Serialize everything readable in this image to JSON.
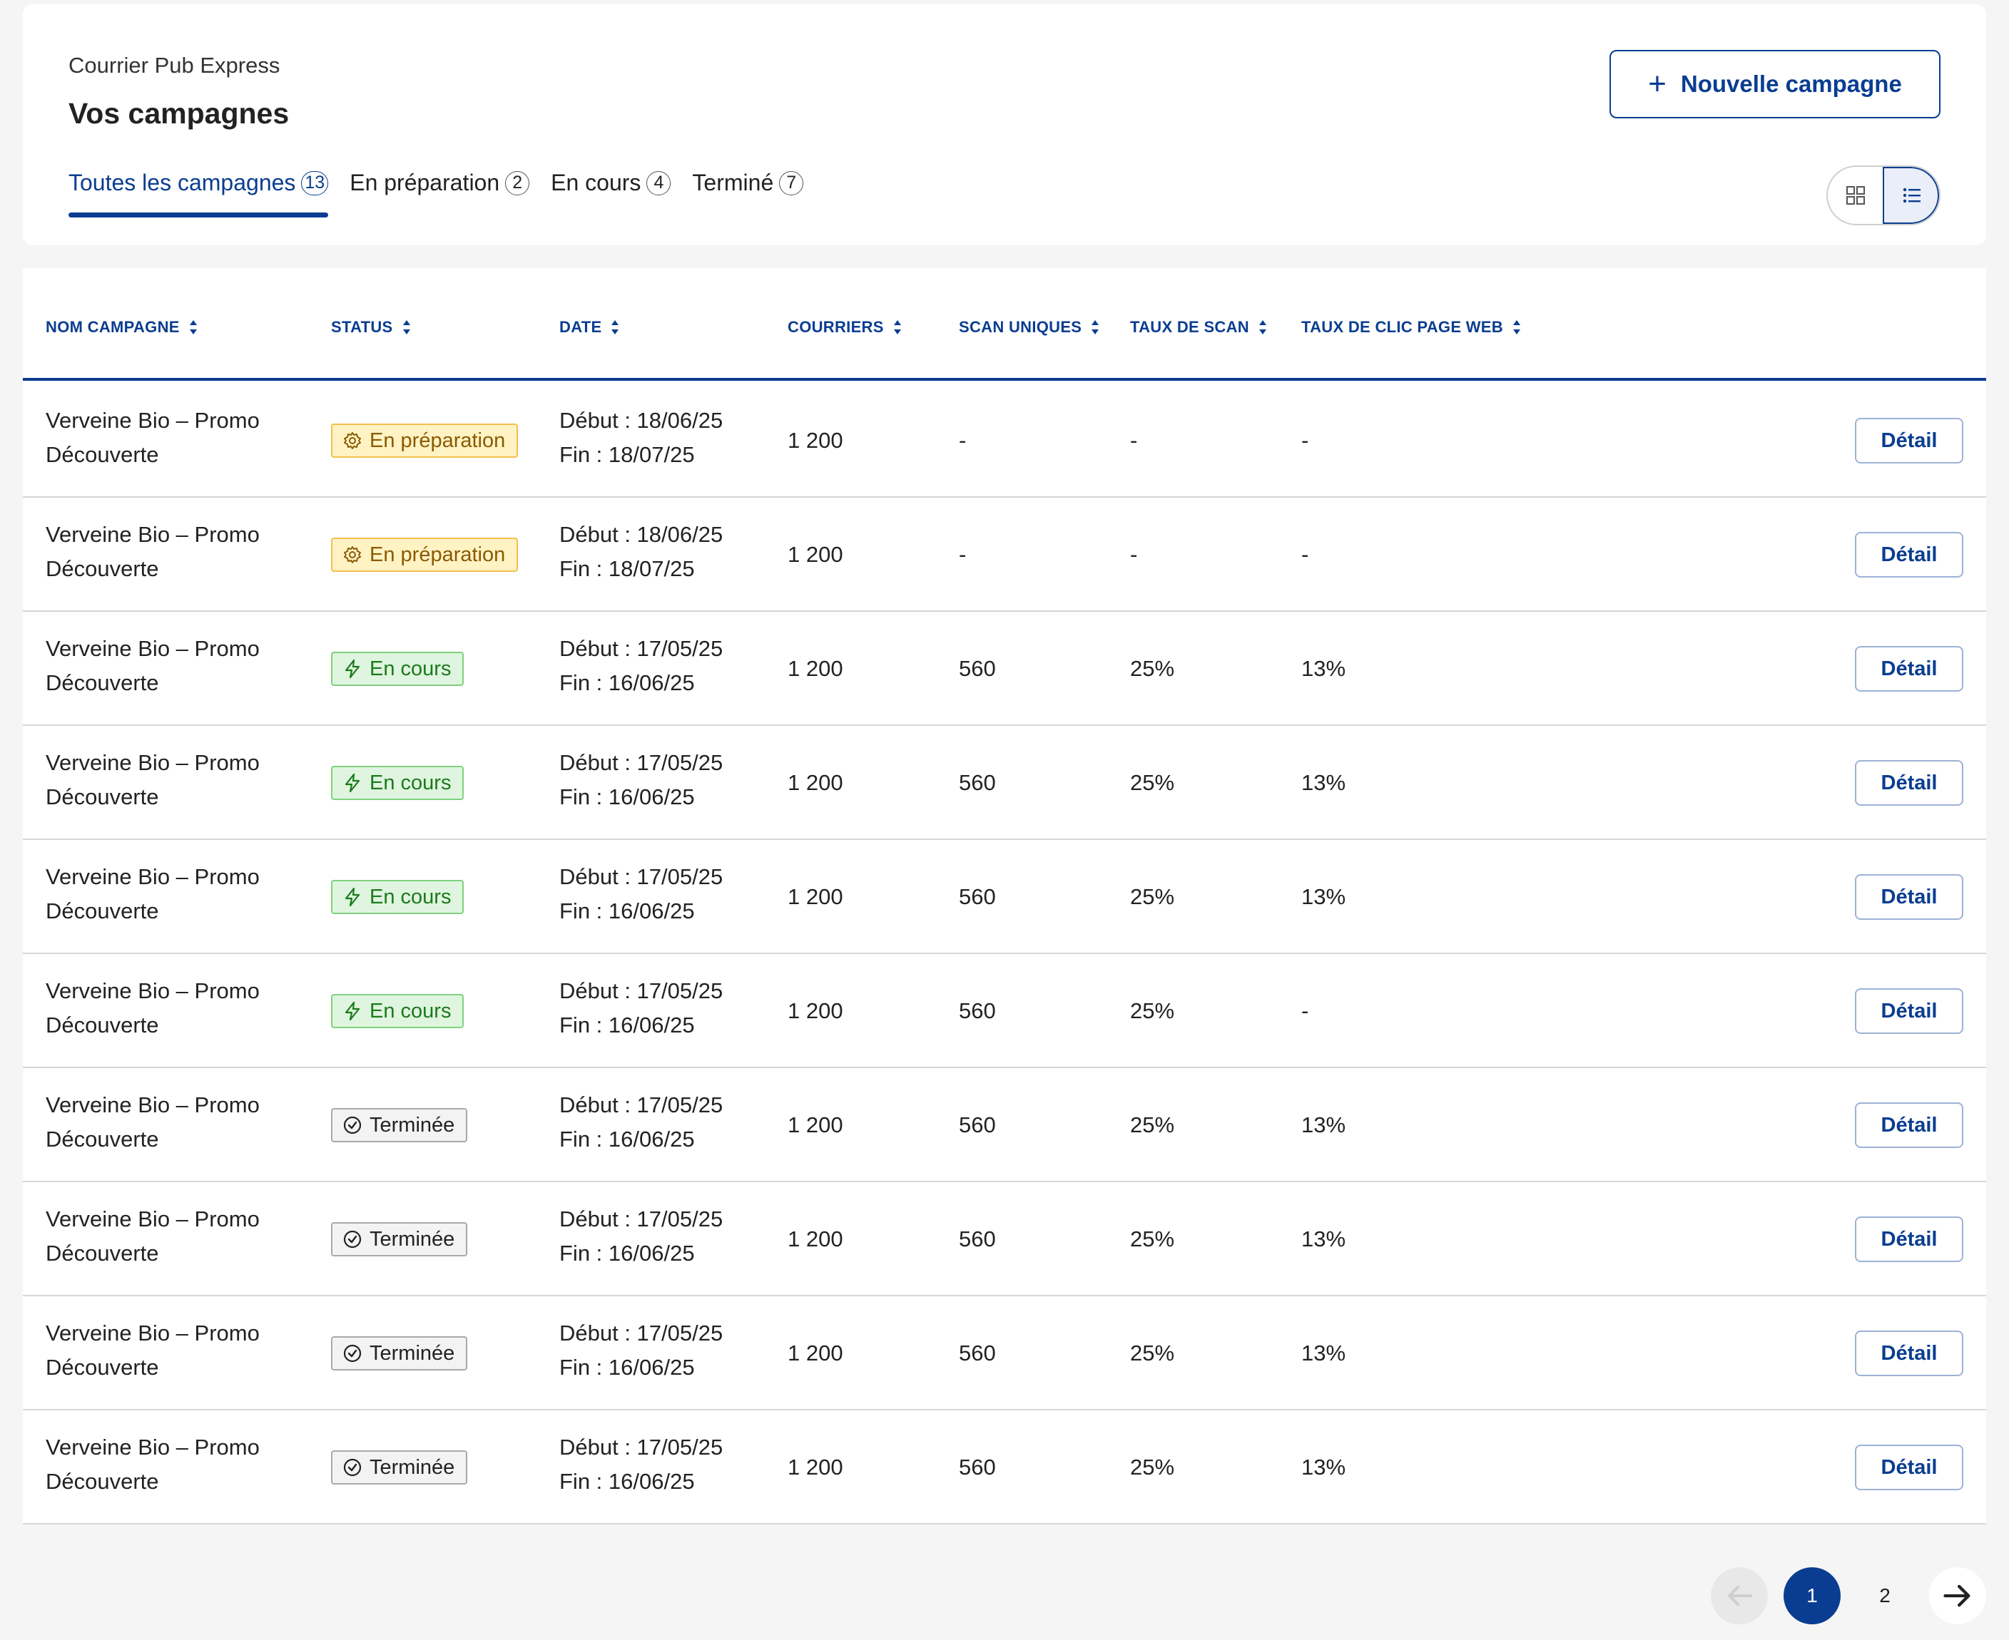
{
  "header": {
    "brand": "Courrier Pub Express",
    "title": "Vos campagnes",
    "new_button": "Nouvelle campagne",
    "new_button_icon": "plus-icon"
  },
  "tabs": [
    {
      "label": "Toutes les campagnes",
      "count": "13",
      "active": true
    },
    {
      "label": "En préparation",
      "count": "2",
      "active": false
    },
    {
      "label": "En cours",
      "count": "4",
      "active": false
    },
    {
      "label": "Terminé",
      "count": "7",
      "active": false
    }
  ],
  "view_toggle": {
    "options": [
      "grid-view-icon",
      "list-view-icon"
    ],
    "selected": "list"
  },
  "table": {
    "columns": [
      "NOM CAMPAGNE",
      "STATUS",
      "DATE",
      "COURRIERS",
      "SCAN UNIQUES",
      "TAUX DE SCAN",
      "TAUX DE CLIC PAGE WEB"
    ],
    "detail_label": "Détail",
    "rows": [
      {
        "name": "Verveine Bio – Promo Découverte",
        "status": "En préparation",
        "status_type": "prep",
        "start": "Début : 18/06/25",
        "end": "Fin : 18/07/25",
        "courriers": "1 200",
        "scans": "-",
        "scan_rate": "-",
        "click_rate": "-"
      },
      {
        "name": "Verveine Bio – Promo Découverte",
        "status": "En préparation",
        "status_type": "prep",
        "start": "Début : 18/06/25",
        "end": "Fin : 18/07/25",
        "courriers": "1 200",
        "scans": "-",
        "scan_rate": "-",
        "click_rate": "-"
      },
      {
        "name": "Verveine Bio – Promo Découverte",
        "status": "En cours",
        "status_type": "cours",
        "start": "Début : 17/05/25",
        "end": "Fin : 16/06/25",
        "courriers": "1 200",
        "scans": "560",
        "scan_rate": "25%",
        "click_rate": "13%"
      },
      {
        "name": "Verveine Bio – Promo Découverte",
        "status": "En cours",
        "status_type": "cours",
        "start": "Début : 17/05/25",
        "end": "Fin : 16/06/25",
        "courriers": "1 200",
        "scans": "560",
        "scan_rate": "25%",
        "click_rate": "13%"
      },
      {
        "name": "Verveine Bio – Promo Découverte",
        "status": "En cours",
        "status_type": "cours",
        "start": "Début : 17/05/25",
        "end": "Fin : 16/06/25",
        "courriers": "1 200",
        "scans": "560",
        "scan_rate": "25%",
        "click_rate": "13%"
      },
      {
        "name": "Verveine Bio – Promo Découverte",
        "status": "En cours",
        "status_type": "cours",
        "start": "Début : 17/05/25",
        "end": "Fin : 16/06/25",
        "courriers": "1 200",
        "scans": "560",
        "scan_rate": "25%",
        "click_rate": "-"
      },
      {
        "name": "Verveine Bio – Promo Découverte",
        "status": "Terminée",
        "status_type": "done",
        "start": "Début : 17/05/25",
        "end": "Fin : 16/06/25",
        "courriers": "1 200",
        "scans": "560",
        "scan_rate": "25%",
        "click_rate": "13%"
      },
      {
        "name": "Verveine Bio – Promo Découverte",
        "status": "Terminée",
        "status_type": "done",
        "start": "Début : 17/05/25",
        "end": "Fin : 16/06/25",
        "courriers": "1 200",
        "scans": "560",
        "scan_rate": "25%",
        "click_rate": "13%"
      },
      {
        "name": "Verveine Bio – Promo Découverte",
        "status": "Terminée",
        "status_type": "done",
        "start": "Début : 17/05/25",
        "end": "Fin : 16/06/25",
        "courriers": "1 200",
        "scans": "560",
        "scan_rate": "25%",
        "click_rate": "13%"
      },
      {
        "name": "Verveine Bio – Promo Découverte",
        "status": "Terminée",
        "status_type": "done",
        "start": "Début : 17/05/25",
        "end": "Fin : 16/06/25",
        "courriers": "1 200",
        "scans": "560",
        "scan_rate": "25%",
        "click_rate": "13%"
      }
    ]
  },
  "pagination": {
    "pages": [
      "1",
      "2"
    ],
    "current": "1",
    "prev_icon": "arrow-left-icon",
    "next_icon": "arrow-right-icon"
  },
  "colors": {
    "accent": "#0a3d91",
    "prep": "#f2c04a",
    "cours": "#7fd17f",
    "done": "#a9a9a9"
  }
}
